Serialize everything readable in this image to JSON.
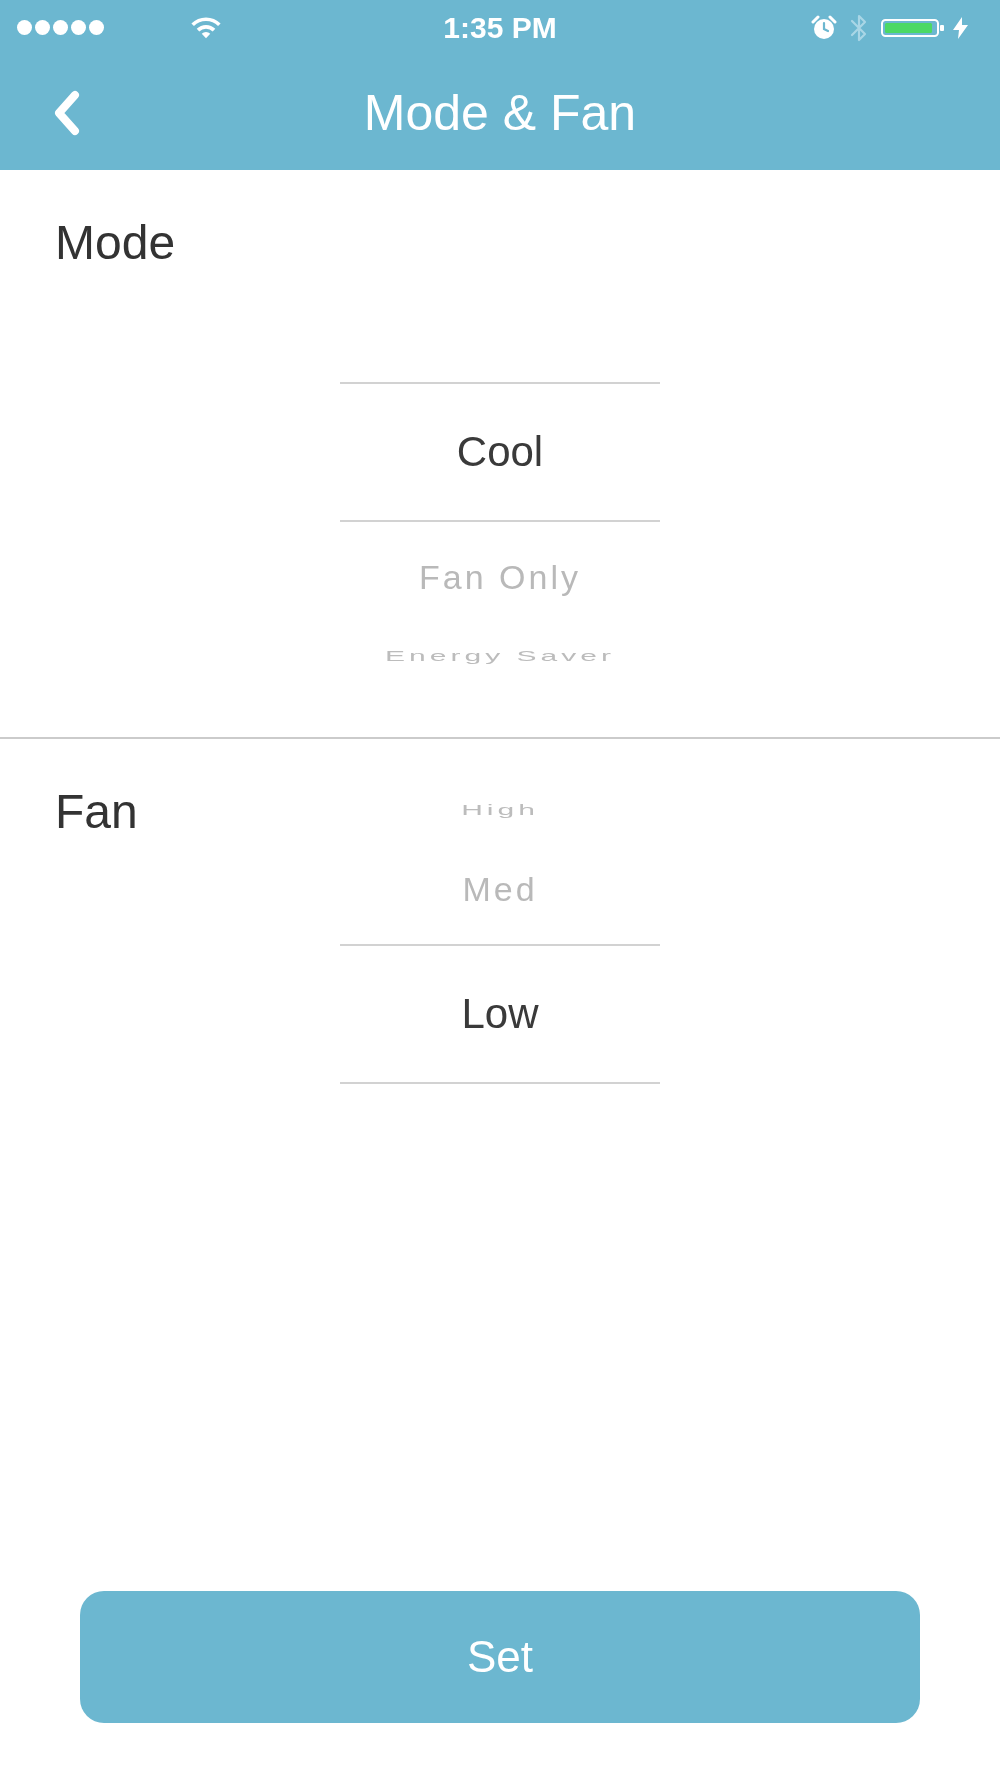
{
  "status_bar": {
    "time": "1:35 PM"
  },
  "header": {
    "title": "Mode & Fan"
  },
  "sections": [
    {
      "label": "Mode",
      "options": [
        {
          "label": "Cool",
          "selected": true
        },
        {
          "label": "Fan Only",
          "selected": false
        },
        {
          "label": "Energy Saver",
          "selected": false
        }
      ]
    },
    {
      "label": "Fan",
      "options": [
        {
          "label": "High",
          "selected": false
        },
        {
          "label": "Med",
          "selected": false
        },
        {
          "label": "Low",
          "selected": true
        }
      ]
    }
  ],
  "set_button": {
    "label": "Set"
  }
}
